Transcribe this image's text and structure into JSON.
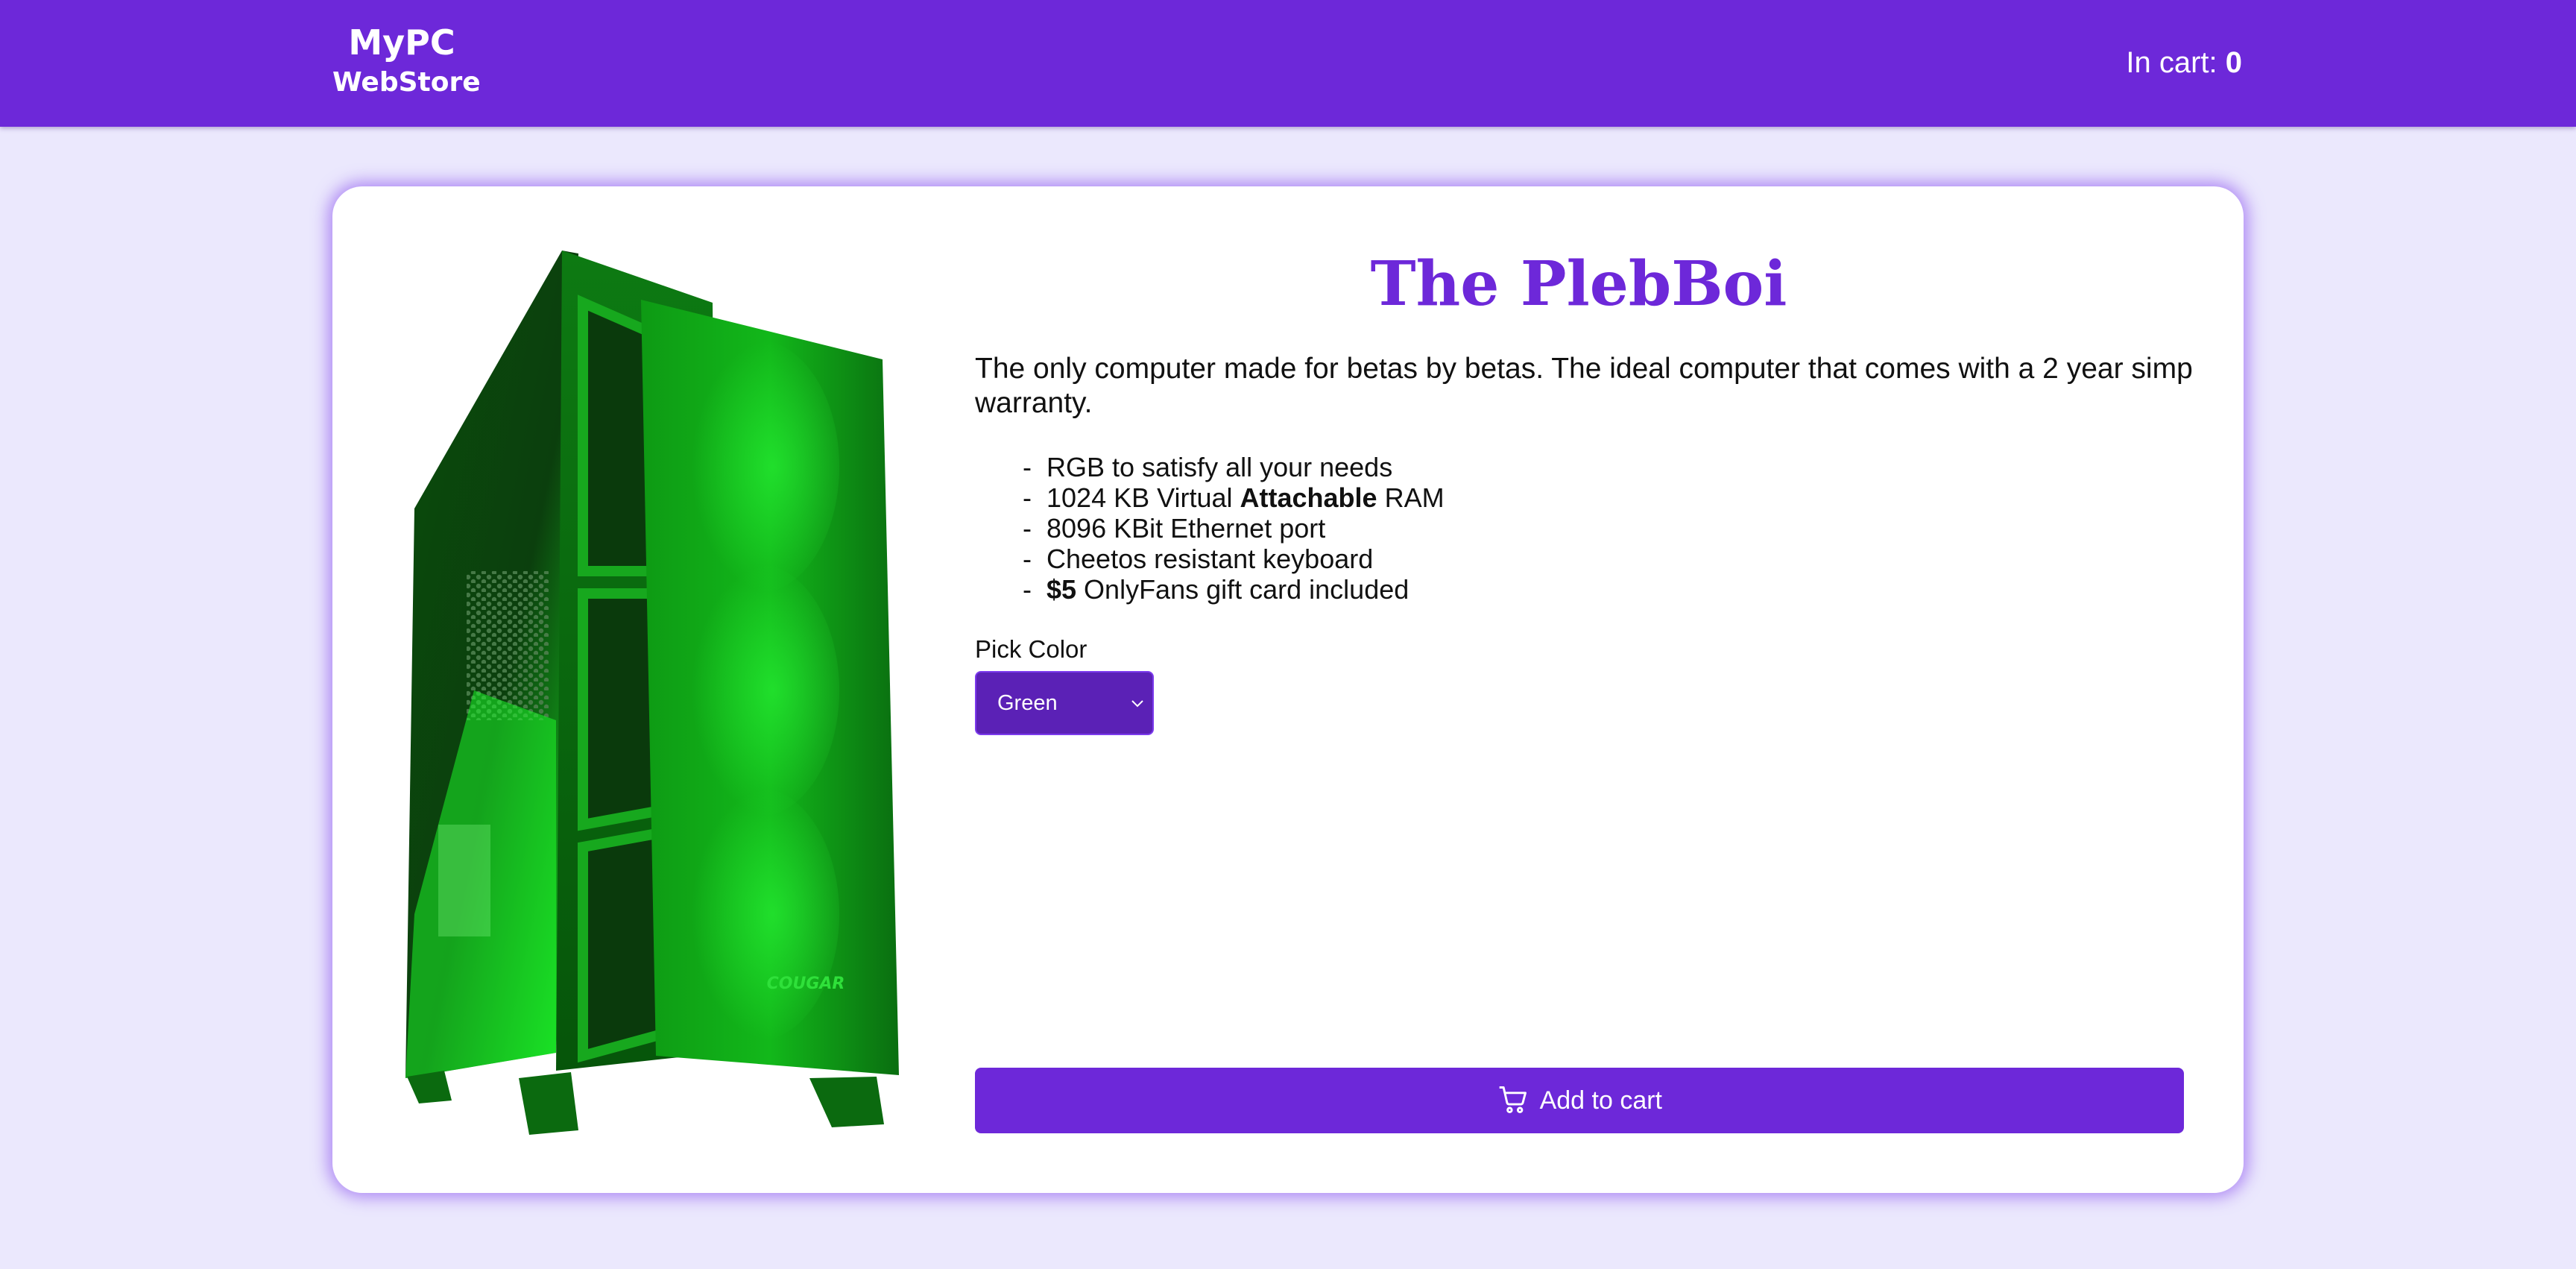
{
  "header": {
    "brand_name": "MyPC",
    "brand_sub": "WebStore",
    "cart_label": "In cart:",
    "cart_count": "0"
  },
  "product": {
    "image_icon": "pc-case-image",
    "image_text": "COUGAR",
    "title": "The PlebBoi",
    "description": "The only computer made for betas by betas. The ideal computer that comes with a 2 year simp warranty.",
    "features": [
      {
        "dash": "-",
        "before": "RGB to satisfy all your needs",
        "bold": "",
        "after": ""
      },
      {
        "dash": "-",
        "before": "1024 KB Virtual ",
        "bold": "Attachable",
        "after": " RAM"
      },
      {
        "dash": "-",
        "before": "8096 KBit Ethernet port",
        "bold": "",
        "after": ""
      },
      {
        "dash": "-",
        "before": "Cheetos resistant keyboard",
        "bold": "",
        "after": ""
      },
      {
        "dash": "-",
        "before": "",
        "bold": "$5",
        "after": " OnlyFans gift card included"
      }
    ],
    "color_label": "Pick Color",
    "color_selected": "Green",
    "add_to_cart_label": "Add to cart",
    "add_to_cart_icon": "cart-icon"
  },
  "colors": {
    "accent": "#6d28d9",
    "background": "#ebe8fd",
    "select_bg": "#5b21b6",
    "product_green": "#10c018"
  }
}
